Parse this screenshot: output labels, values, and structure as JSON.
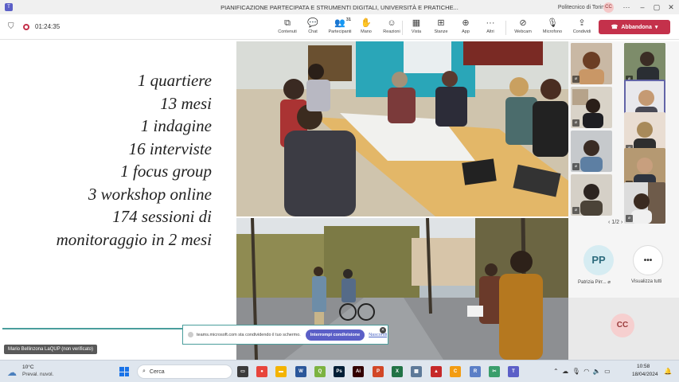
{
  "window": {
    "title": "PIANIFICAZIONE PARTECIPATA E STRUMENTI DIGITALI, UNIVERSITÀ E PRATICHE...",
    "organization": "Politecnico di Torino",
    "user_initials": "CC",
    "app_icon": "teams-icon"
  },
  "toolbar": {
    "timer": "01:24:35",
    "buttons": [
      {
        "name": "content",
        "label": "Contenuti",
        "icon": "content-icon"
      },
      {
        "name": "chat",
        "label": "Chat",
        "icon": "chat-icon"
      },
      {
        "name": "participants",
        "label": "Partecipanti",
        "icon": "people-icon",
        "count": "31"
      },
      {
        "name": "raise-hand",
        "label": "Mano",
        "icon": "hand-icon"
      },
      {
        "name": "reactions",
        "label": "Reazioni",
        "icon": "smiley-icon"
      },
      {
        "name": "view",
        "label": "Vista",
        "icon": "grid-icon"
      },
      {
        "name": "rooms",
        "label": "Stanze",
        "icon": "rooms-icon"
      },
      {
        "name": "apps",
        "label": "App",
        "icon": "plus-icon"
      },
      {
        "name": "more",
        "label": "Altri",
        "icon": "more-icon"
      },
      {
        "name": "camera",
        "label": "Webcam",
        "icon": "camera-off-icon"
      },
      {
        "name": "mic",
        "label": "Microfono",
        "icon": "mic-off-icon"
      },
      {
        "name": "share",
        "label": "Condividi",
        "icon": "share-icon"
      }
    ],
    "leave_label": "Abbandona"
  },
  "slide": {
    "lines": [
      "1 quartiere",
      "13 mesi",
      "1 indagine",
      "16 interviste",
      "1 focus group",
      "3 workshop online",
      "174 sessioni di",
      "monitoraggio in 2 mesi"
    ],
    "accent_color": "#4a9d9c"
  },
  "presenter": {
    "name_tag": "Mario Bellinzona LaQUP (non verificato)"
  },
  "sharing_bar": {
    "message": "teams.microsoft.com sta condividendo il tuo schermo.",
    "stop_label": "Interrompi condivisione",
    "hide_label": "Nascondi"
  },
  "participants_panel": {
    "pager": "1/2",
    "featured": [
      {
        "initials": "PP",
        "name": "Patrizia Pirr..."
      },
      {
        "initials": "•••",
        "name": "Visualizza tutti"
      }
    ]
  },
  "self_view": {
    "initials": "CC"
  },
  "taskbar": {
    "weather_temp": "10°C",
    "weather_desc": "Preval. nuvol.",
    "search_placeholder": "Cerca",
    "time": "10:58",
    "date": "18/04/2024"
  }
}
